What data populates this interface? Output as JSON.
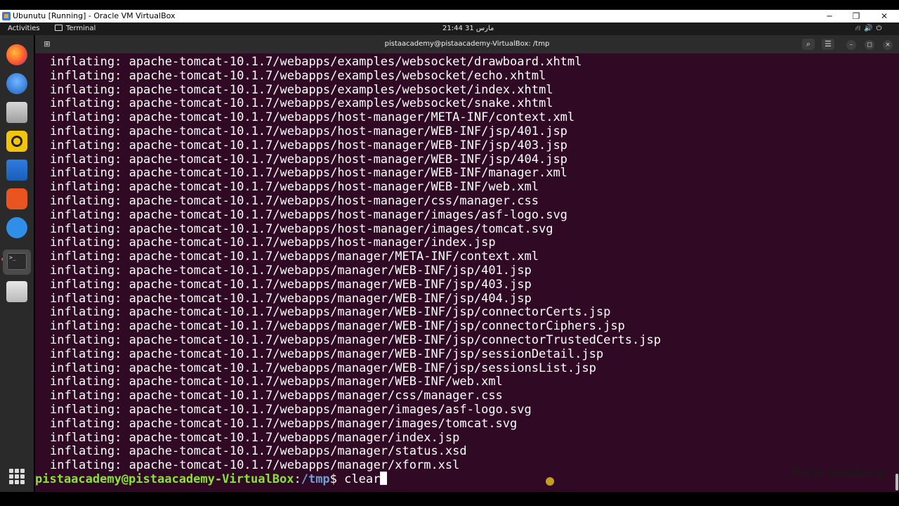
{
  "vbox": {
    "title": "Ubunutu [Running] - Oracle VM VirtualBox",
    "minimize": "─",
    "restore": "❐",
    "close": "✕"
  },
  "topbar": {
    "activities": "Activities",
    "app_name": "Terminal",
    "clock": "مارس 31  21:44",
    "tray": "⛙🔊⏻"
  },
  "terminal": {
    "title": "pistaacademy@pistaacademy-VirtualBox: /tmp",
    "lines": [
      "inflating: apache-tomcat-10.1.7/webapps/examples/websocket/drawboard.xhtml",
      "inflating: apache-tomcat-10.1.7/webapps/examples/websocket/echo.xhtml",
      "inflating: apache-tomcat-10.1.7/webapps/examples/websocket/index.xhtml",
      "inflating: apache-tomcat-10.1.7/webapps/examples/websocket/snake.xhtml",
      "inflating: apache-tomcat-10.1.7/webapps/host-manager/META-INF/context.xml",
      "inflating: apache-tomcat-10.1.7/webapps/host-manager/WEB-INF/jsp/401.jsp",
      "inflating: apache-tomcat-10.1.7/webapps/host-manager/WEB-INF/jsp/403.jsp",
      "inflating: apache-tomcat-10.1.7/webapps/host-manager/WEB-INF/jsp/404.jsp",
      "inflating: apache-tomcat-10.1.7/webapps/host-manager/WEB-INF/manager.xml",
      "inflating: apache-tomcat-10.1.7/webapps/host-manager/WEB-INF/web.xml",
      "inflating: apache-tomcat-10.1.7/webapps/host-manager/css/manager.css",
      "inflating: apache-tomcat-10.1.7/webapps/host-manager/images/asf-logo.svg",
      "inflating: apache-tomcat-10.1.7/webapps/host-manager/images/tomcat.svg",
      "inflating: apache-tomcat-10.1.7/webapps/host-manager/index.jsp",
      "inflating: apache-tomcat-10.1.7/webapps/manager/META-INF/context.xml",
      "inflating: apache-tomcat-10.1.7/webapps/manager/WEB-INF/jsp/401.jsp",
      "inflating: apache-tomcat-10.1.7/webapps/manager/WEB-INF/jsp/403.jsp",
      "inflating: apache-tomcat-10.1.7/webapps/manager/WEB-INF/jsp/404.jsp",
      "inflating: apache-tomcat-10.1.7/webapps/manager/WEB-INF/jsp/connectorCerts.jsp",
      "inflating: apache-tomcat-10.1.7/webapps/manager/WEB-INF/jsp/connectorCiphers.jsp",
      "inflating: apache-tomcat-10.1.7/webapps/manager/WEB-INF/jsp/connectorTrustedCerts.jsp",
      "inflating: apache-tomcat-10.1.7/webapps/manager/WEB-INF/jsp/sessionDetail.jsp",
      "inflating: apache-tomcat-10.1.7/webapps/manager/WEB-INF/jsp/sessionsList.jsp",
      "inflating: apache-tomcat-10.1.7/webapps/manager/WEB-INF/web.xml",
      "inflating: apache-tomcat-10.1.7/webapps/manager/css/manager.css",
      "inflating: apache-tomcat-10.1.7/webapps/manager/images/asf-logo.svg",
      "inflating: apache-tomcat-10.1.7/webapps/manager/images/tomcat.svg",
      "inflating: apache-tomcat-10.1.7/webapps/manager/index.jsp",
      "inflating: apache-tomcat-10.1.7/webapps/manager/status.xsd",
      "inflating: apache-tomcat-10.1.7/webapps/manager/xform.xsl"
    ],
    "prompt_user": "pistaacademy@pistaacademy-VirtualBox",
    "prompt_sep": ":",
    "prompt_path": "/tmp",
    "prompt_dollar": "$ ",
    "command": "clear"
  },
  "watermark": "Pista Academy",
  "dock": [
    "firefox-icon",
    "thunderbird-icon",
    "files-icon",
    "rhythmbox-icon",
    "writer-icon",
    "app-center-icon",
    "help-icon",
    "terminal-icon",
    "trash-icon",
    "show-apps-icon"
  ],
  "colors": {
    "terminal_bg": "#300a24",
    "prompt_user": "#8ae234",
    "prompt_path": "#729fcf",
    "accent": "#e95420"
  }
}
